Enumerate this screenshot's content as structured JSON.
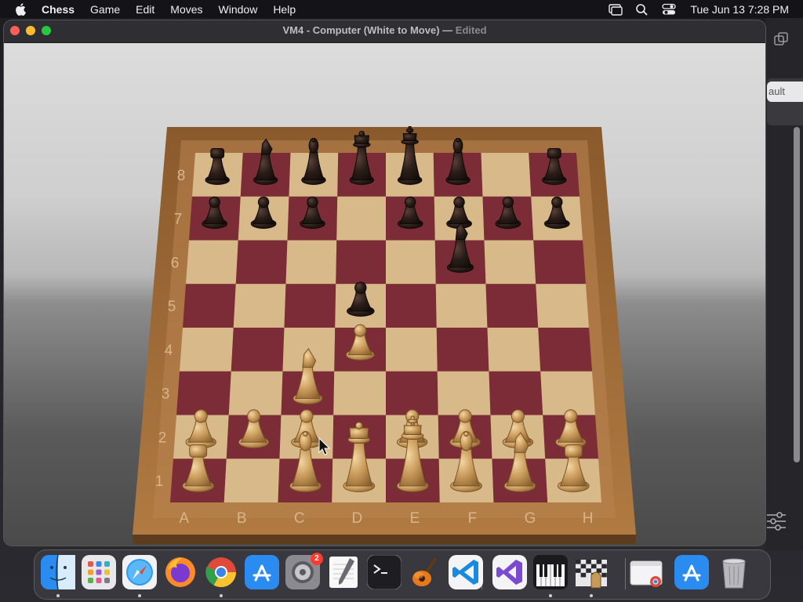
{
  "menubar": {
    "app_name": "Chess",
    "menus": [
      "Game",
      "Edit",
      "Moves",
      "Window",
      "Help"
    ],
    "clock": "Tue Jun 13  7:28 PM"
  },
  "window": {
    "title": "VM4 - Computer   (White to Move)",
    "separator": "—",
    "status": "Edited"
  },
  "board": {
    "files": [
      "A",
      "B",
      "C",
      "D",
      "E",
      "F",
      "G",
      "H"
    ],
    "ranks": [
      "1",
      "2",
      "3",
      "4",
      "5",
      "6",
      "7",
      "8"
    ],
    "pieces": [
      {
        "square": "a8",
        "piece": "rook",
        "color": "black"
      },
      {
        "square": "b8",
        "piece": "knight",
        "color": "black"
      },
      {
        "square": "c8",
        "piece": "bishop",
        "color": "black"
      },
      {
        "square": "d8",
        "piece": "queen",
        "color": "black"
      },
      {
        "square": "e8",
        "piece": "king",
        "color": "black"
      },
      {
        "square": "f8",
        "piece": "bishop",
        "color": "black"
      },
      {
        "square": "h8",
        "piece": "rook",
        "color": "black"
      },
      {
        "square": "a7",
        "piece": "pawn",
        "color": "black"
      },
      {
        "square": "b7",
        "piece": "pawn",
        "color": "black"
      },
      {
        "square": "c7",
        "piece": "pawn",
        "color": "black"
      },
      {
        "square": "e7",
        "piece": "pawn",
        "color": "black"
      },
      {
        "square": "f7",
        "piece": "pawn",
        "color": "black"
      },
      {
        "square": "g7",
        "piece": "pawn",
        "color": "black"
      },
      {
        "square": "h7",
        "piece": "pawn",
        "color": "black"
      },
      {
        "square": "f6",
        "piece": "knight",
        "color": "black"
      },
      {
        "square": "d5",
        "piece": "pawn",
        "color": "black"
      },
      {
        "square": "d4",
        "piece": "pawn",
        "color": "white"
      },
      {
        "square": "c3",
        "piece": "knight",
        "color": "white"
      },
      {
        "square": "a2",
        "piece": "pawn",
        "color": "white"
      },
      {
        "square": "b2",
        "piece": "pawn",
        "color": "white"
      },
      {
        "square": "c2",
        "piece": "pawn",
        "color": "white"
      },
      {
        "square": "e2",
        "piece": "pawn",
        "color": "white"
      },
      {
        "square": "f2",
        "piece": "pawn",
        "color": "white"
      },
      {
        "square": "g2",
        "piece": "pawn",
        "color": "white"
      },
      {
        "square": "h2",
        "piece": "pawn",
        "color": "white"
      },
      {
        "square": "a1",
        "piece": "rook",
        "color": "white"
      },
      {
        "square": "c1",
        "piece": "bishop",
        "color": "white"
      },
      {
        "square": "d1",
        "piece": "queen",
        "color": "white"
      },
      {
        "square": "e1",
        "piece": "king",
        "color": "white"
      },
      {
        "square": "f1",
        "piece": "bishop",
        "color": "white"
      },
      {
        "square": "g1",
        "piece": "knight",
        "color": "white"
      },
      {
        "square": "h1",
        "piece": "rook",
        "color": "white"
      }
    ]
  },
  "background_window": {
    "button_label": "ault"
  },
  "dock": {
    "apps": [
      {
        "name": "Finder",
        "icon": "finder-icon",
        "running": true
      },
      {
        "name": "Launchpad",
        "icon": "launchpad-icon",
        "running": false
      },
      {
        "name": "Safari",
        "icon": "safari-icon",
        "running": true
      },
      {
        "name": "Firefox",
        "icon": "firefox-icon",
        "running": false
      },
      {
        "name": "Google Chrome",
        "icon": "chrome-icon",
        "running": true
      },
      {
        "name": "App Store",
        "icon": "app-store-icon",
        "running": false
      },
      {
        "name": "System Settings",
        "icon": "system-settings-icon",
        "running": false,
        "badge": "2"
      },
      {
        "name": "TextEdit",
        "icon": "textedit-icon",
        "running": false
      },
      {
        "name": "Terminal",
        "icon": "terminal-icon",
        "running": false
      },
      {
        "name": "GarageBand",
        "icon": "garageband-icon",
        "running": false
      },
      {
        "name": "Visual Studio Code",
        "icon": "vscode-icon",
        "running": false
      },
      {
        "name": "Visual Studio",
        "icon": "visual-studio-icon",
        "running": false
      },
      {
        "name": "Piano",
        "icon": "piano-icon",
        "running": true
      },
      {
        "name": "Chess",
        "icon": "chess-icon",
        "running": true
      },
      {
        "name": "Chrome Window",
        "icon": "chrome-window-icon",
        "running": false
      },
      {
        "name": "App Store Downloads",
        "icon": "app-store-downloads-icon",
        "running": false
      },
      {
        "name": "Trash",
        "icon": "trash-icon",
        "running": false
      }
    ]
  },
  "colors": {
    "light_square": "#d8b98a",
    "dark_square": "#7b2c36",
    "frame": "#a06a36",
    "black_piece": "#2a1d18",
    "white_piece": "#c99a5a"
  }
}
